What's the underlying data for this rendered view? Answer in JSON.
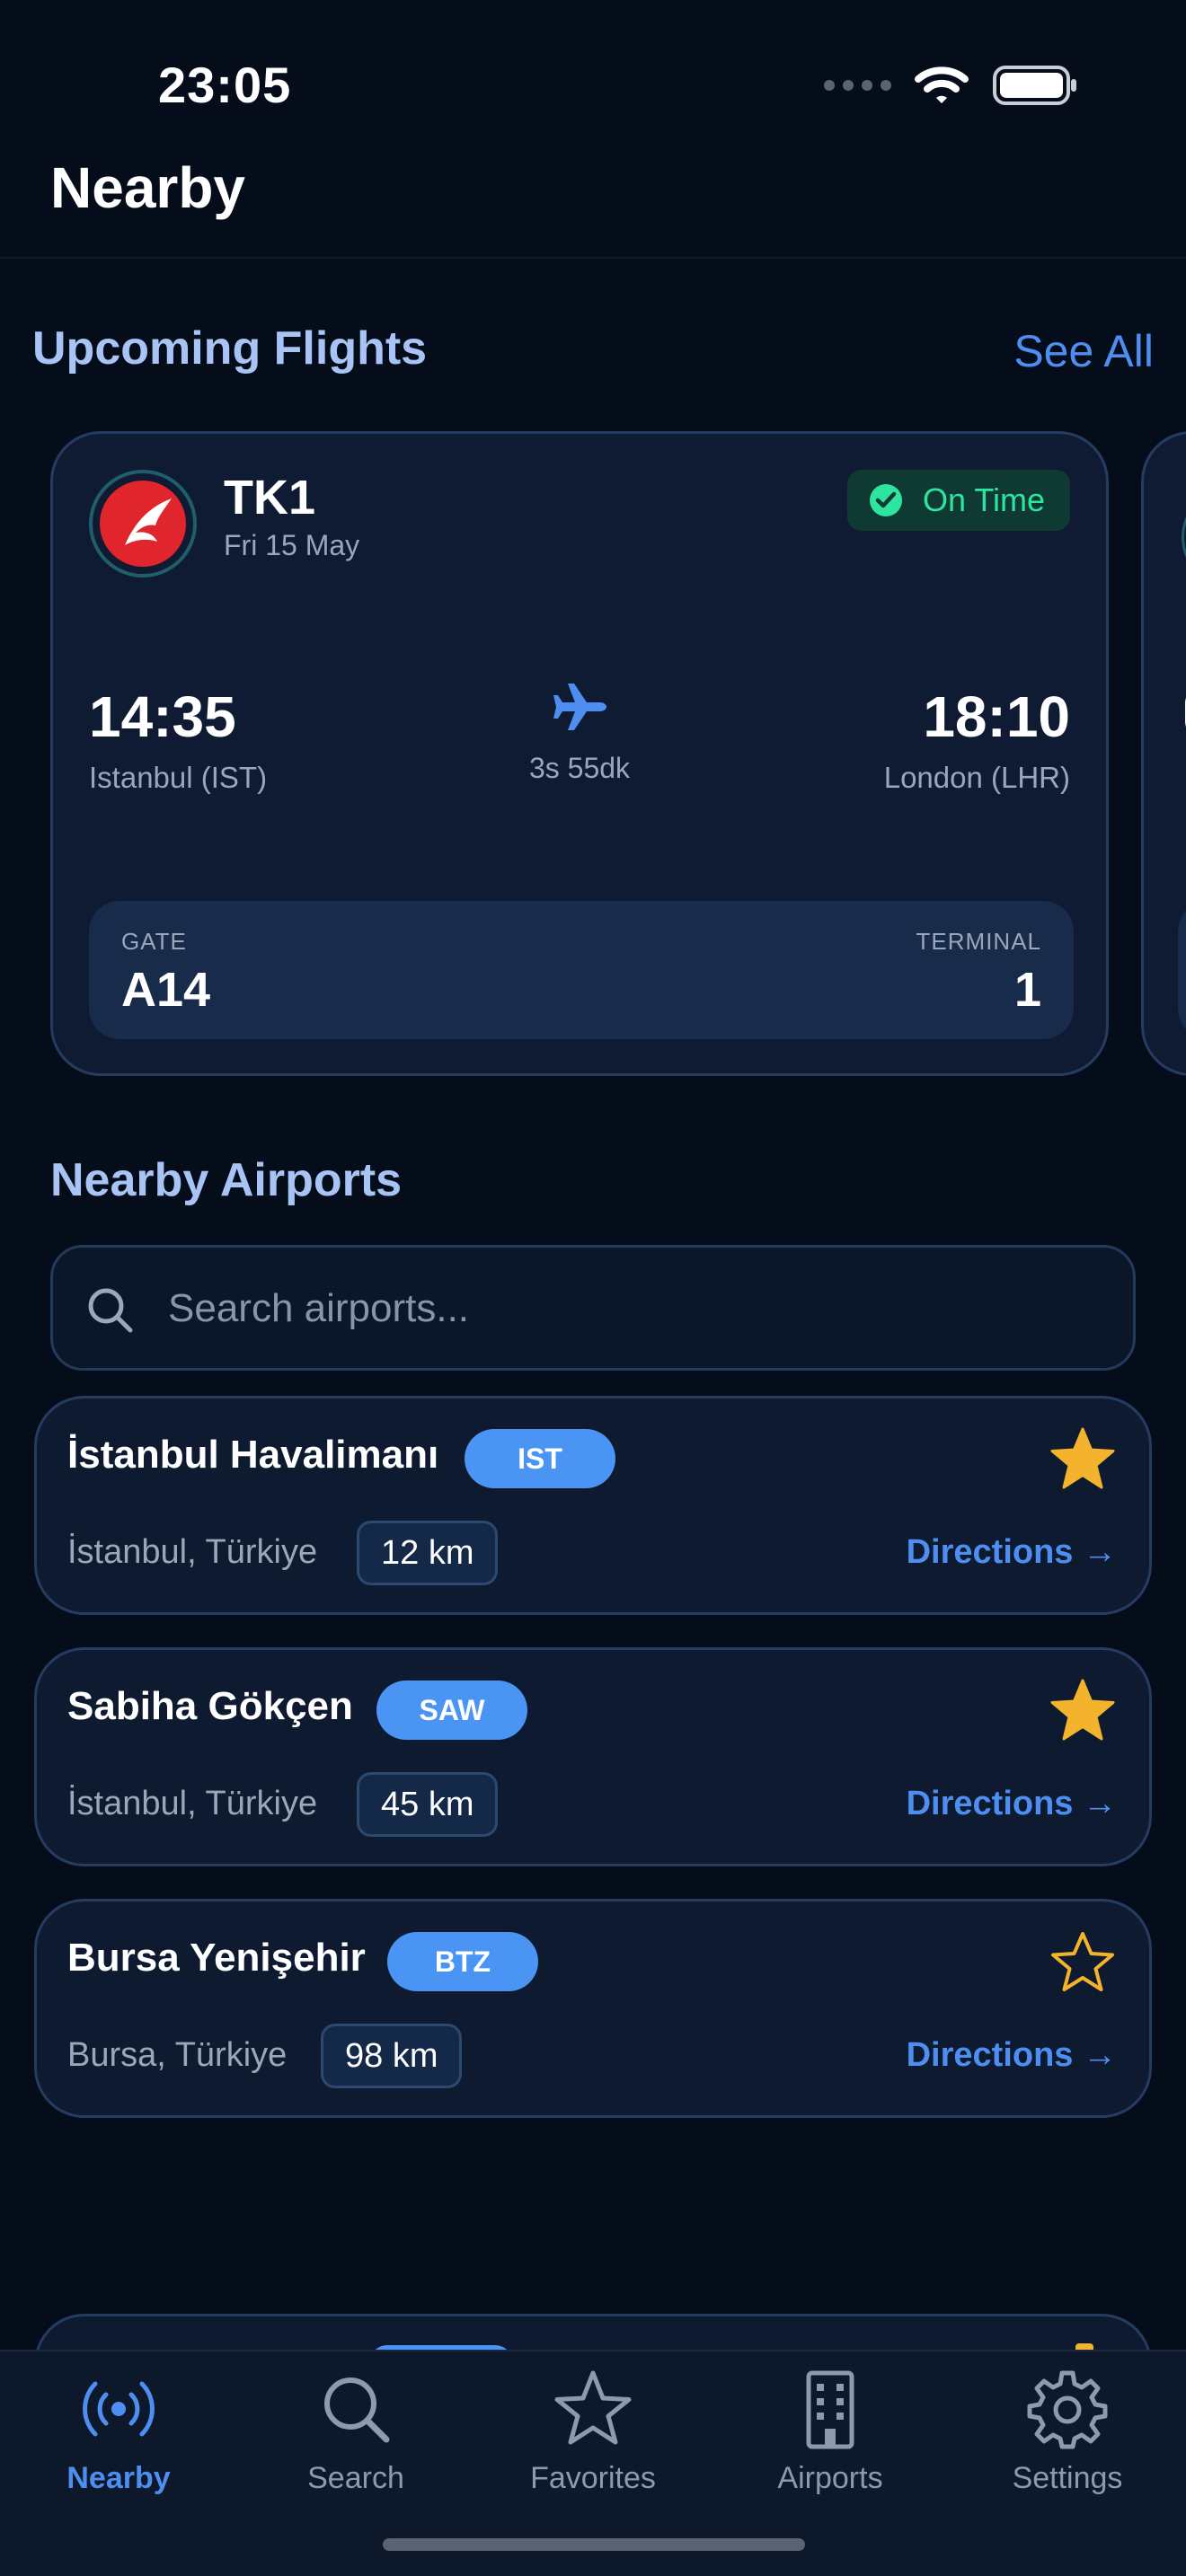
{
  "status_bar": {
    "time": "23:05"
  },
  "header": {
    "title": "Nearby"
  },
  "upcoming": {
    "title": "Upcoming Flights",
    "see_all": "See All",
    "flight": {
      "number": "TK1",
      "date": "Fri 15 May",
      "status": "On Time",
      "departure_time": "14:35",
      "departure_airport": "Istanbul (IST)",
      "arrival_time": "18:10",
      "arrival_airport": "London (LHR)",
      "duration": "3s 55dk",
      "gate_label": "GATE",
      "gate": "A14",
      "terminal_label": "TERMINAL",
      "terminal": "1"
    }
  },
  "nearby": {
    "title": "Nearby Airports",
    "search_placeholder": "Search airports...",
    "airports": [
      {
        "name": "İstanbul Havalimanı",
        "code": "IST",
        "location": "İstanbul, Türkiye",
        "distance": "12 km",
        "directions": "Directions →",
        "favorite": true
      },
      {
        "name": "Sabiha Gökçen",
        "code": "SAW",
        "location": "İstanbul, Türkiye",
        "distance": "45 km",
        "directions": "Directions →",
        "favorite": true
      },
      {
        "name": "Bursa Yenişehir",
        "code": "BTZ",
        "location": "Bursa, Türkiye",
        "distance": "98 km",
        "directions": "Directions →",
        "favorite": false
      }
    ]
  },
  "tabs": [
    {
      "label": "Nearby",
      "icon": "broadcast-icon",
      "active": true
    },
    {
      "label": "Search",
      "icon": "search-icon",
      "active": false
    },
    {
      "label": "Favorites",
      "icon": "star-icon",
      "active": false
    },
    {
      "label": "Airports",
      "icon": "building-icon",
      "active": false
    },
    {
      "label": "Settings",
      "icon": "gear-icon",
      "active": false
    }
  ],
  "colors": {
    "background": "#050c1a",
    "accent": "#4d8ef0",
    "status_green": "#2ee5a0",
    "star_gold": "#f3b32c",
    "airline_red": "#e0252c"
  }
}
